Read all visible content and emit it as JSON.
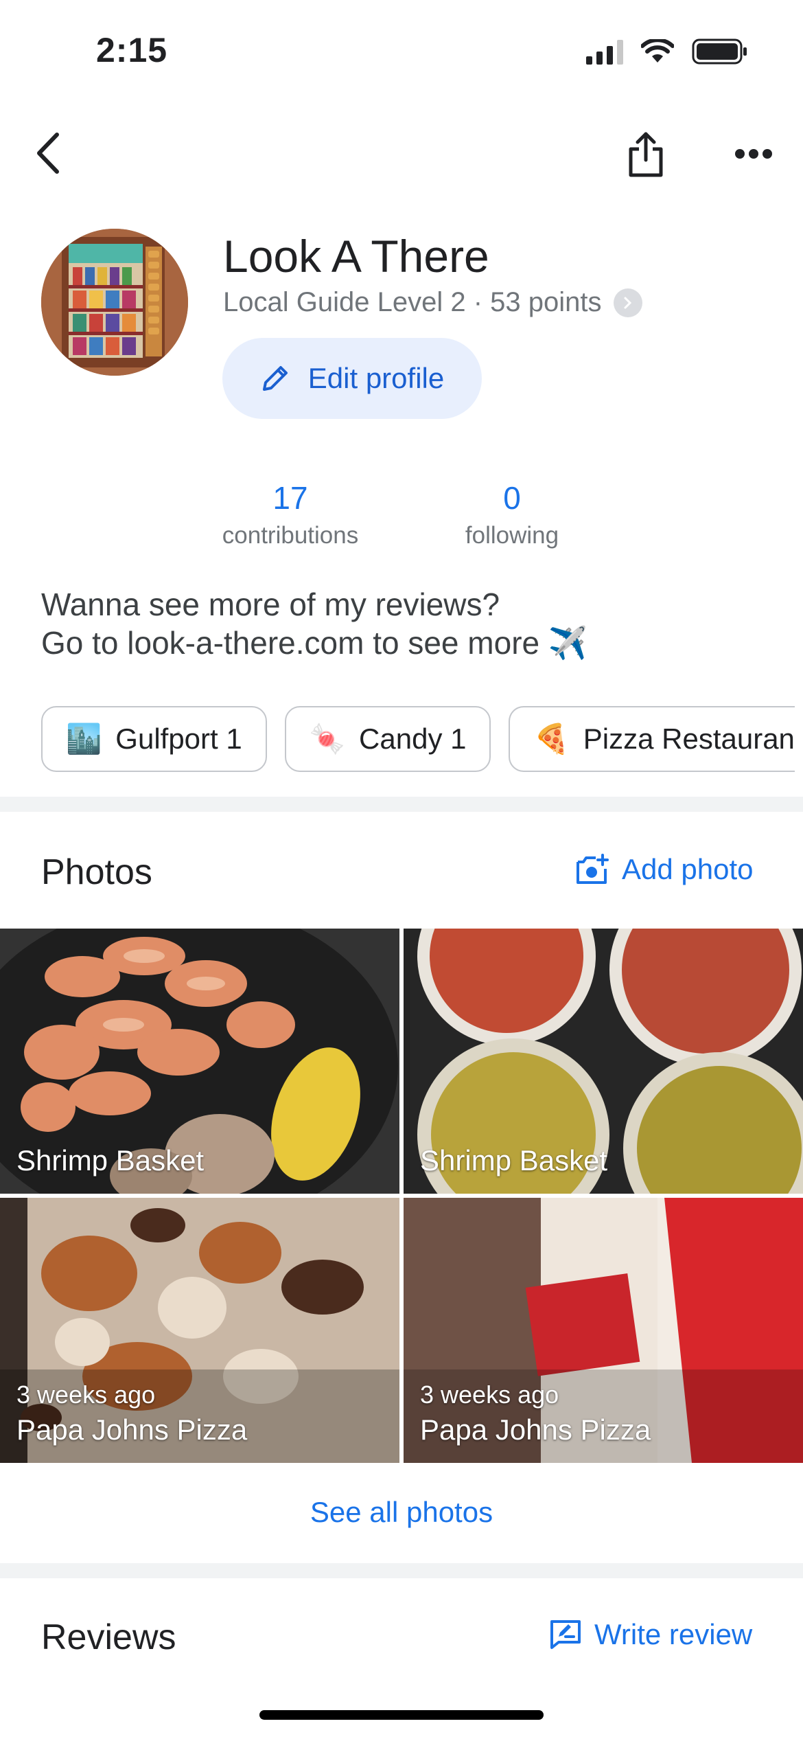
{
  "status_bar": {
    "time": "2:15"
  },
  "top_bar": {
    "back_icon": "back-arrow-icon",
    "share_icon": "share-icon",
    "more_icon": "more-horiz-icon"
  },
  "profile": {
    "name": "Look A There",
    "level_text": "Local Guide Level 2 · 53 points",
    "edit_label": "Edit profile"
  },
  "stats": [
    {
      "value": "17",
      "label": "contributions"
    },
    {
      "value": "0",
      "label": "following"
    }
  ],
  "bio": {
    "line1": "Wanna see more of my reviews?",
    "line2": "Go to look-a-there.com to see more ✈️"
  },
  "chips": [
    {
      "emoji": "🏙️",
      "label": "Gulfport 1"
    },
    {
      "emoji": "🍬",
      "label": "Candy 1"
    },
    {
      "emoji": "🍕",
      "label": "Pizza Restauran"
    }
  ],
  "photos_section": {
    "title": "Photos",
    "add_label": "Add photo",
    "items": [
      {
        "sub": "",
        "caption": "Shrimp Basket"
      },
      {
        "sub": "",
        "caption": "Shrimp Basket"
      },
      {
        "sub": "3 weeks ago",
        "caption": "Papa Johns Pizza"
      },
      {
        "sub": "3 weeks ago",
        "caption": "Papa Johns Pizza"
      }
    ],
    "see_all": "See all photos"
  },
  "reviews_section": {
    "title": "Reviews",
    "write_label": "Write review"
  },
  "colors": {
    "accent": "#1a73e8",
    "chip_border": "#c4c7cc",
    "edit_bg": "#e8effd"
  }
}
